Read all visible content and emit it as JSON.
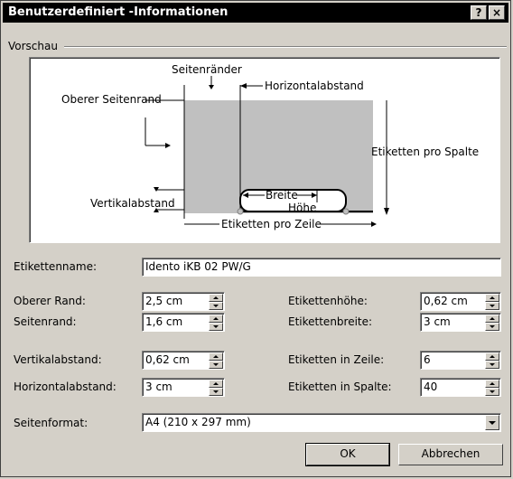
{
  "window": {
    "title": "Benutzerdefiniert  -Informationen",
    "help_button": "?",
    "close_button": "×"
  },
  "preview": {
    "group_label": "Vorschau",
    "labels": {
      "seitenraender": "Seitenränder",
      "oberer_seitenrand": "Oberer Seitenrand",
      "horizontalabstand": "Horizontalabstand",
      "etiketten_pro_spalte": "Etiketten pro Spalte",
      "vertikalabstand": "Vertikalabstand",
      "breite": "Breite",
      "hoehe": "Höhe",
      "etiketten_pro_zeile": "Etiketten pro Zeile"
    }
  },
  "form": {
    "etikettenname": {
      "label": "Etikettenname:",
      "value": "Idento iKB 02 PW/G"
    },
    "oberer_rand": {
      "label": "Oberer Rand:",
      "value": "2,5 cm"
    },
    "seitenrand": {
      "label": "Seitenrand:",
      "value": "1,6 cm"
    },
    "vertikalabstand": {
      "label": "Vertikalabstand:",
      "value": "0,62 cm"
    },
    "horizontalabstand": {
      "label": "Horizontalabstand:",
      "value": "3 cm"
    },
    "etikettenhoehe": {
      "label": "Etikettenhöhe:",
      "value": "0,62 cm"
    },
    "etikettenbreite": {
      "label": "Etikettenbreite:",
      "value": "3 cm"
    },
    "etiketten_in_zeile": {
      "label": "Etiketten in Zeile:",
      "value": "6"
    },
    "etiketten_in_spalte": {
      "label": "Etiketten in Spalte:",
      "value": "40"
    },
    "seitenformat": {
      "label": "Seitenformat:",
      "value": "A4 (210 x 297 mm)"
    }
  },
  "buttons": {
    "ok": "OK",
    "abbrechen": "Abbrechen"
  }
}
